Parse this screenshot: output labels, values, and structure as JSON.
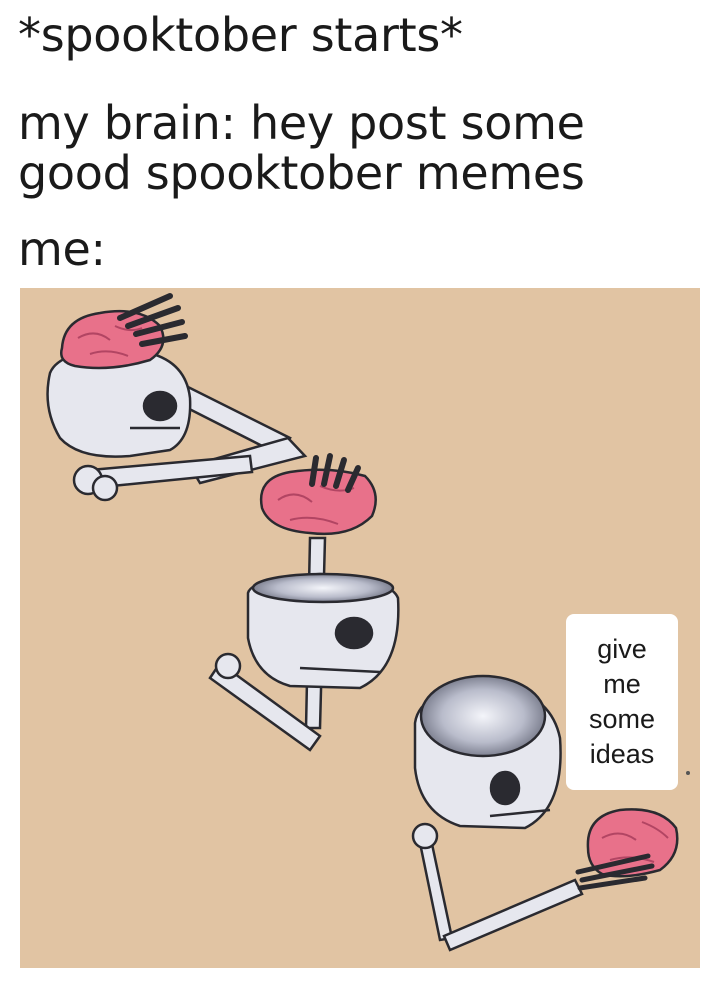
{
  "caption": {
    "line1": "*spooktober starts*",
    "line2": "my brain: hey post some",
    "line3": "good spooktober memes",
    "line4": "me:"
  },
  "note": {
    "words": [
      "give",
      "me",
      "some",
      "ideas"
    ]
  },
  "colors": {
    "background": "#e1c4a3",
    "bone": "#e6e7ee",
    "brain": "#e8718a",
    "caption_text": "#1a1a1a"
  }
}
